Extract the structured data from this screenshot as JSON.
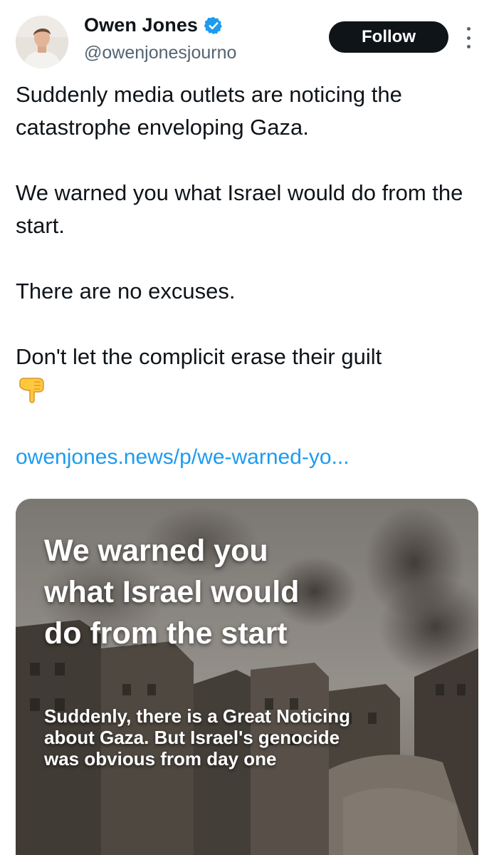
{
  "author": {
    "name": "Owen Jones",
    "handle": "@owenjonesjourno",
    "verified": true
  },
  "follow_button_label": "Follow",
  "tweet": {
    "paragraphs": [
      "Suddenly media outlets are noticing the catastrophe enveloping Gaza.",
      "We warned you what Israel would do from the start.",
      "There are no excuses.",
      "Don't let the complicit erase their guilt"
    ],
    "emoji_icon": "backhand-index-pointing-down-icon",
    "link_text": "owenjones.news/p/we-warned-yo..."
  },
  "link_card": {
    "headline": "We warned you what Israel would do from the start",
    "subtitle": "Suddenly, there is a Great Noticing about Gaza. But Israel's genocide was obvious from day one"
  },
  "colors": {
    "text": "#0f1419",
    "secondary_text": "#536471",
    "link": "#1d9bf0",
    "follow_button_bg": "#0f1419",
    "verified_badge": "#1d9bf0"
  }
}
